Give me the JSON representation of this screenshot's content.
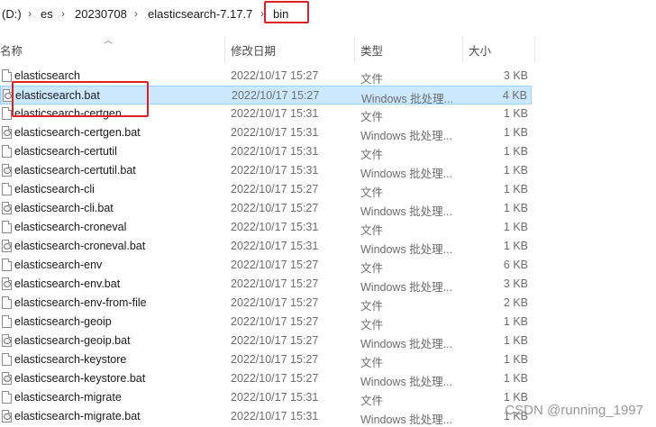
{
  "breadcrumb": {
    "drive": "(D:)",
    "items": [
      "es",
      "20230708",
      "elasticsearch-7.17.7",
      "bin"
    ],
    "separator": "›"
  },
  "columns": {
    "name": "名称",
    "date": "修改日期",
    "type": "类型",
    "size": "大小"
  },
  "files": [
    {
      "name": "elasticsearch",
      "date": "2022/10/17 15:27",
      "type": "文件",
      "size": "3 KB",
      "icon": "file-icon"
    },
    {
      "name": "elasticsearch.bat",
      "date": "2022/10/17 15:27",
      "type": "Windows 批处理...",
      "size": "4 KB",
      "icon": "batch-file-icon",
      "selected": true
    },
    {
      "name": "elasticsearch-certgen",
      "date": "2022/10/17 15:31",
      "type": "文件",
      "size": "1 KB",
      "icon": "file-icon"
    },
    {
      "name": "elasticsearch-certgen.bat",
      "date": "2022/10/17 15:31",
      "type": "Windows 批处理...",
      "size": "1 KB",
      "icon": "batch-file-icon"
    },
    {
      "name": "elasticsearch-certutil",
      "date": "2022/10/17 15:31",
      "type": "文件",
      "size": "1 KB",
      "icon": "file-icon"
    },
    {
      "name": "elasticsearch-certutil.bat",
      "date": "2022/10/17 15:31",
      "type": "Windows 批处理...",
      "size": "1 KB",
      "icon": "batch-file-icon"
    },
    {
      "name": "elasticsearch-cli",
      "date": "2022/10/17 15:27",
      "type": "文件",
      "size": "1 KB",
      "icon": "file-icon"
    },
    {
      "name": "elasticsearch-cli.bat",
      "date": "2022/10/17 15:27",
      "type": "Windows 批处理...",
      "size": "1 KB",
      "icon": "batch-file-icon"
    },
    {
      "name": "elasticsearch-croneval",
      "date": "2022/10/17 15:31",
      "type": "文件",
      "size": "1 KB",
      "icon": "file-icon"
    },
    {
      "name": "elasticsearch-croneval.bat",
      "date": "2022/10/17 15:31",
      "type": "Windows 批处理...",
      "size": "1 KB",
      "icon": "batch-file-icon"
    },
    {
      "name": "elasticsearch-env",
      "date": "2022/10/17 15:27",
      "type": "文件",
      "size": "6 KB",
      "icon": "file-icon"
    },
    {
      "name": "elasticsearch-env.bat",
      "date": "2022/10/17 15:27",
      "type": "Windows 批处理...",
      "size": "3 KB",
      "icon": "batch-file-icon"
    },
    {
      "name": "elasticsearch-env-from-file",
      "date": "2022/10/17 15:27",
      "type": "文件",
      "size": "2 KB",
      "icon": "file-icon"
    },
    {
      "name": "elasticsearch-geoip",
      "date": "2022/10/17 15:27",
      "type": "文件",
      "size": "1 KB",
      "icon": "file-icon"
    },
    {
      "name": "elasticsearch-geoip.bat",
      "date": "2022/10/17 15:27",
      "type": "Windows 批处理...",
      "size": "1 KB",
      "icon": "batch-file-icon"
    },
    {
      "name": "elasticsearch-keystore",
      "date": "2022/10/17 15:27",
      "type": "文件",
      "size": "1 KB",
      "icon": "file-icon"
    },
    {
      "name": "elasticsearch-keystore.bat",
      "date": "2022/10/17 15:27",
      "type": "Windows 批处理...",
      "size": "1 KB",
      "icon": "batch-file-icon"
    },
    {
      "name": "elasticsearch-migrate",
      "date": "2022/10/17 15:31",
      "type": "文件",
      "size": "1 KB",
      "icon": "file-icon"
    },
    {
      "name": "elasticsearch-migrate.bat",
      "date": "2022/10/17 15:31",
      "type": "Windows 批处理...",
      "size": "1 KB",
      "icon": "batch-file-icon"
    }
  ],
  "watermark": "CSDN @running_1997",
  "colors": {
    "selection_bg": "#cce8ff",
    "selection_border": "#99d1ff",
    "highlight_box": "#e02020"
  }
}
